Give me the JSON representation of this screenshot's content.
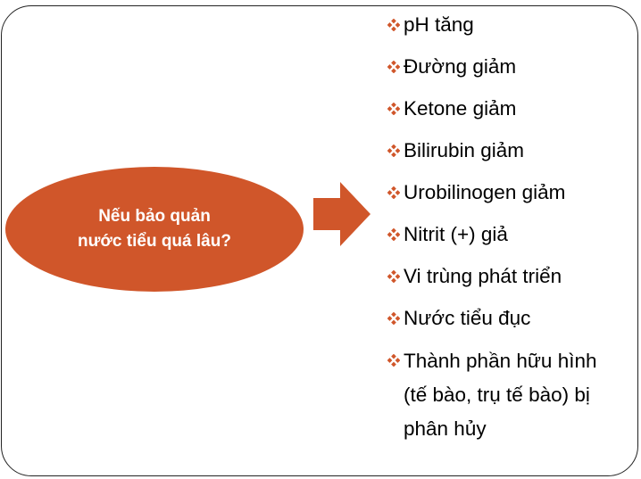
{
  "question": {
    "line1": "Nếu bảo quản",
    "line2": "nước tiểu quá lâu?"
  },
  "colors": {
    "accent": "#d0562a",
    "bullet": "#d0562a",
    "text": "#000000",
    "frame": "#222222"
  },
  "consequences": [
    {
      "text": "pH tăng"
    },
    {
      "text": "Đường giảm"
    },
    {
      "text": "Ketone giảm"
    },
    {
      "text": "Bilirubin giảm"
    },
    {
      "text": "Urobilinogen giảm"
    },
    {
      "text": "Nitrit (+) giả"
    },
    {
      "text": "Vi trùng phát triển"
    },
    {
      "text": "Nước tiểu đục"
    }
  ],
  "last_consequence": {
    "line1": "Thành phần hữu hình",
    "line2": "(tế bào, trụ tế bào) bị",
    "line3": "phân hủy"
  }
}
